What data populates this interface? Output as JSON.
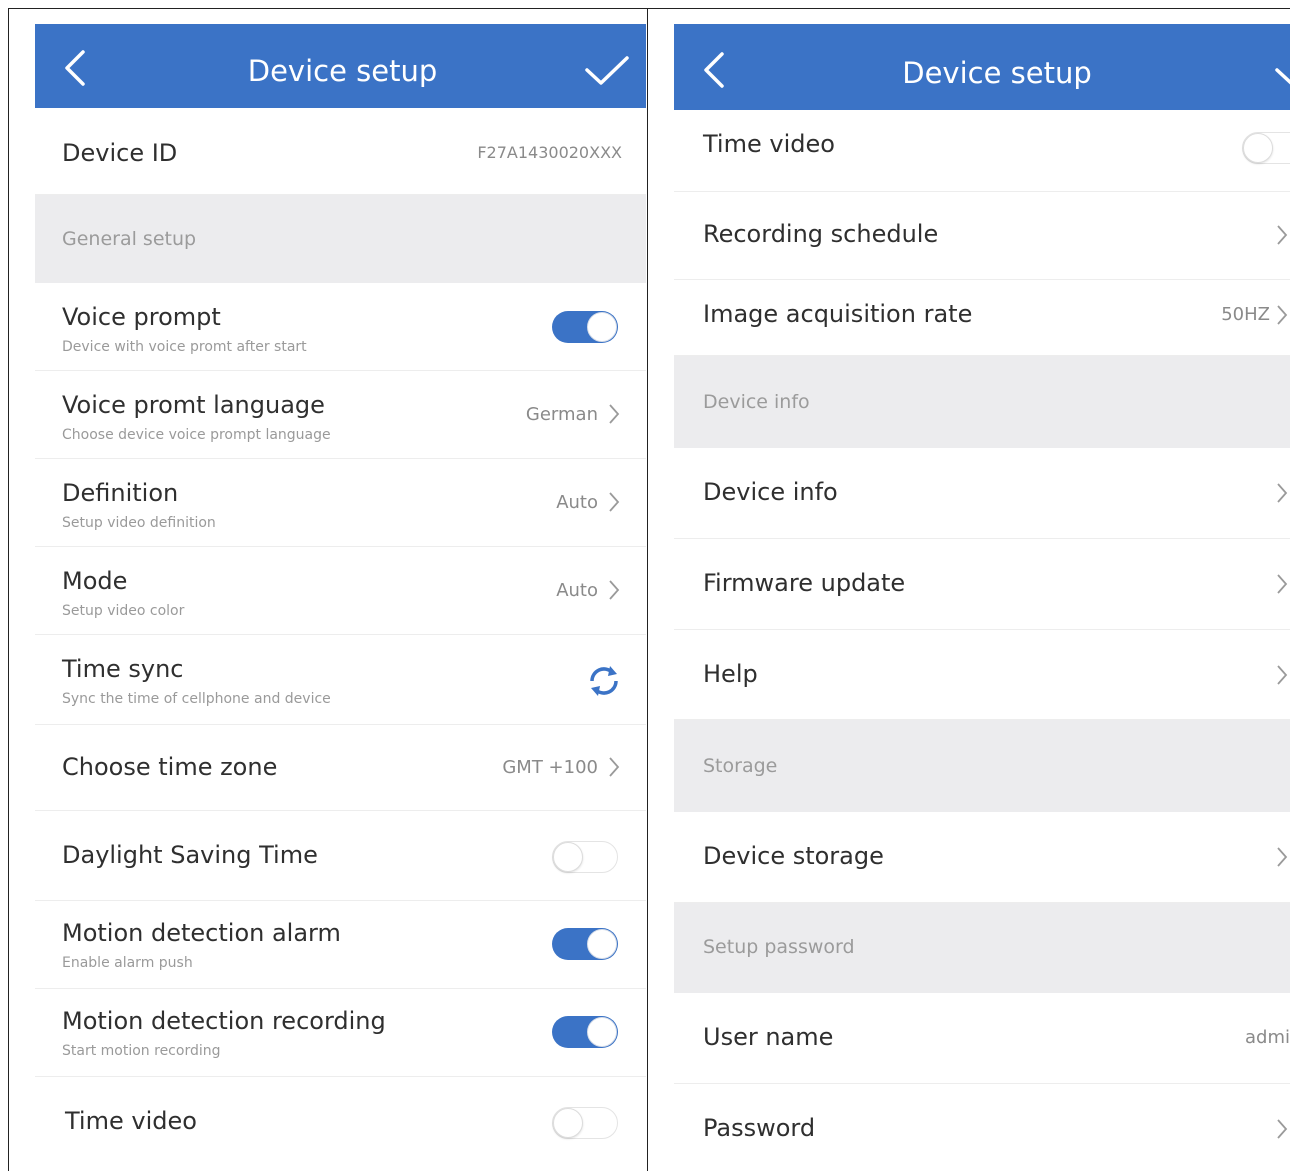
{
  "left": {
    "title": "Device setup",
    "device_id": {
      "label": "Device ID",
      "value": "F27A1430020XXX"
    },
    "general_section": "General setup",
    "voice_prompt": {
      "label": "Voice prompt",
      "sub": "Device with voice promt after start"
    },
    "voice_language": {
      "label": "Voice promt language",
      "sub": "Choose device voice prompt language",
      "value": "German"
    },
    "definition": {
      "label": "Definition",
      "sub": "Setup video definition",
      "value": "Auto"
    },
    "mode": {
      "label": "Mode",
      "sub": "Setup video color",
      "value": "Auto"
    },
    "time_sync": {
      "label": "Time sync",
      "sub": "Sync the time of cellphone and device"
    },
    "time_zone": {
      "label": "Choose time zone",
      "value": "GMT +100"
    },
    "dst": {
      "label": "Daylight Saving Time"
    },
    "motion_alarm": {
      "label": "Motion detection alarm",
      "sub": "Enable alarm push"
    },
    "motion_recording": {
      "label": "Motion detection recording",
      "sub": "Start motion recording"
    },
    "time_video": {
      "label": "Time video"
    }
  },
  "right": {
    "title": "Device setup",
    "time_video": {
      "label": "Time video"
    },
    "recording_schedule": {
      "label": "Recording schedule"
    },
    "image_rate": {
      "label": "Image acquisition rate",
      "value": "50HZ"
    },
    "device_info_section": "Device info",
    "device_info": {
      "label": "Device info"
    },
    "firmware_update": {
      "label": "Firmware update"
    },
    "help": {
      "label": "Help"
    },
    "storage_section": "Storage",
    "device_storage": {
      "label": "Device storage"
    },
    "password_section": "Setup password",
    "user_name": {
      "label": "User name",
      "value": "admi"
    },
    "password": {
      "label": "Password"
    }
  },
  "toggles": {
    "voice_prompt": "on",
    "dst": "off",
    "motion_alarm": "on",
    "motion_recording": "on",
    "left_time_video": "off",
    "right_time_video": "off"
  },
  "colors": {
    "accent": "#3b73c6",
    "section_bg": "#ececee"
  },
  "icons": {
    "back": "chevron-left-icon",
    "confirm": "checkmark-icon",
    "row_arrow": "chevron-right-icon",
    "sync": "sync-icon"
  }
}
